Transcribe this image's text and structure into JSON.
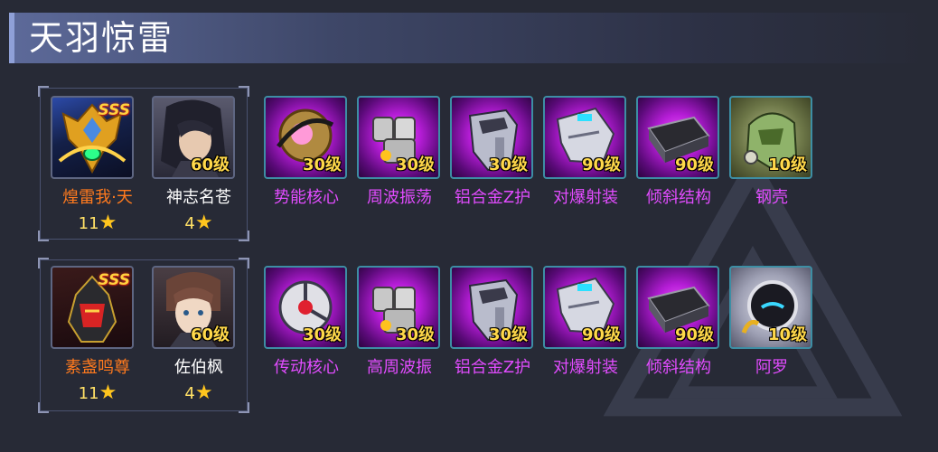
{
  "header": {
    "title": "天羽惊雷"
  },
  "teams": [
    {
      "heroes": [
        {
          "name": "煌雷我·天",
          "stars": "11",
          "badge": "SSS",
          "level": "",
          "name_color": "#ff7a1e",
          "portrait": "golden-mecha-portrait"
        },
        {
          "name": "神志名苍",
          "stars": "4",
          "badge": "",
          "level": "60级",
          "name_color": "#ffffff",
          "portrait": "dark-haired-man-portrait"
        }
      ],
      "equipment": [
        {
          "name": "势能核心",
          "level": "30级",
          "icon": "energy-core-icon"
        },
        {
          "name": "周波振荡",
          "level": "30级",
          "icon": "oscillator-icon"
        },
        {
          "name": "铝合金Z护",
          "level": "30级",
          "icon": "alloy-armor-icon"
        },
        {
          "name": "对爆射装",
          "level": "90级",
          "icon": "gauntlet-icon"
        },
        {
          "name": "倾斜结构",
          "level": "90级",
          "icon": "tilted-structure-icon"
        },
        {
          "name": "钢壳",
          "level": "10级",
          "icon": "steel-shell-icon"
        }
      ]
    },
    {
      "heroes": [
        {
          "name": "素盏鸣尊",
          "stars": "11",
          "badge": "SSS",
          "level": "",
          "name_color": "#ff7a1e",
          "portrait": "red-mecha-portrait"
        },
        {
          "name": "佐伯枫",
          "stars": "4",
          "badge": "",
          "level": "60级",
          "name_color": "#ffffff",
          "portrait": "brown-haired-boy-portrait"
        }
      ],
      "equipment": [
        {
          "name": "传动核心",
          "level": "30级",
          "icon": "drive-core-icon"
        },
        {
          "name": "高周波振",
          "level": "30级",
          "icon": "oscillator-icon"
        },
        {
          "name": "铝合金Z护",
          "level": "30级",
          "icon": "alloy-armor-icon"
        },
        {
          "name": "对爆射装",
          "level": "90级",
          "icon": "gauntlet-icon"
        },
        {
          "name": "倾斜结构",
          "level": "90级",
          "icon": "tilted-structure-icon"
        },
        {
          "name": "阿罗",
          "level": "10级",
          "icon": "robot-pet-icon"
        }
      ]
    }
  ]
}
